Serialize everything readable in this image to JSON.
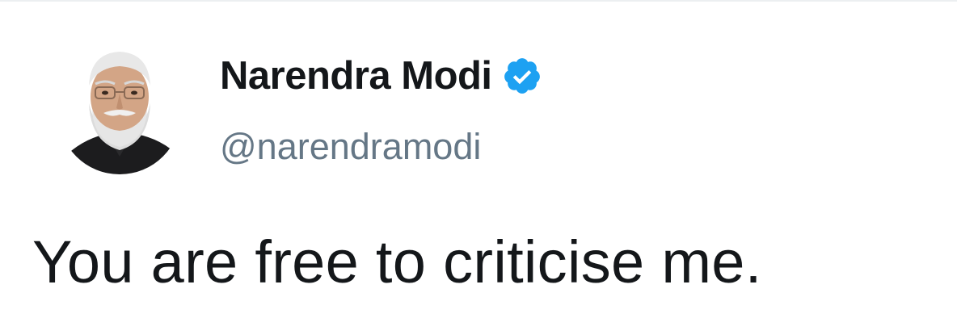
{
  "author": {
    "display_name": "Narendra Modi",
    "handle": "@narendramodi",
    "verified": true,
    "avatar_icon": "profile-photo",
    "badge_icon": "verified-check-icon",
    "badge_color": "#1da1f2"
  },
  "tweet": {
    "text": "You are free to criticise me."
  },
  "colors": {
    "name": "#14171a",
    "handle": "#657786",
    "text": "#14171a",
    "background": "#ffffff"
  }
}
